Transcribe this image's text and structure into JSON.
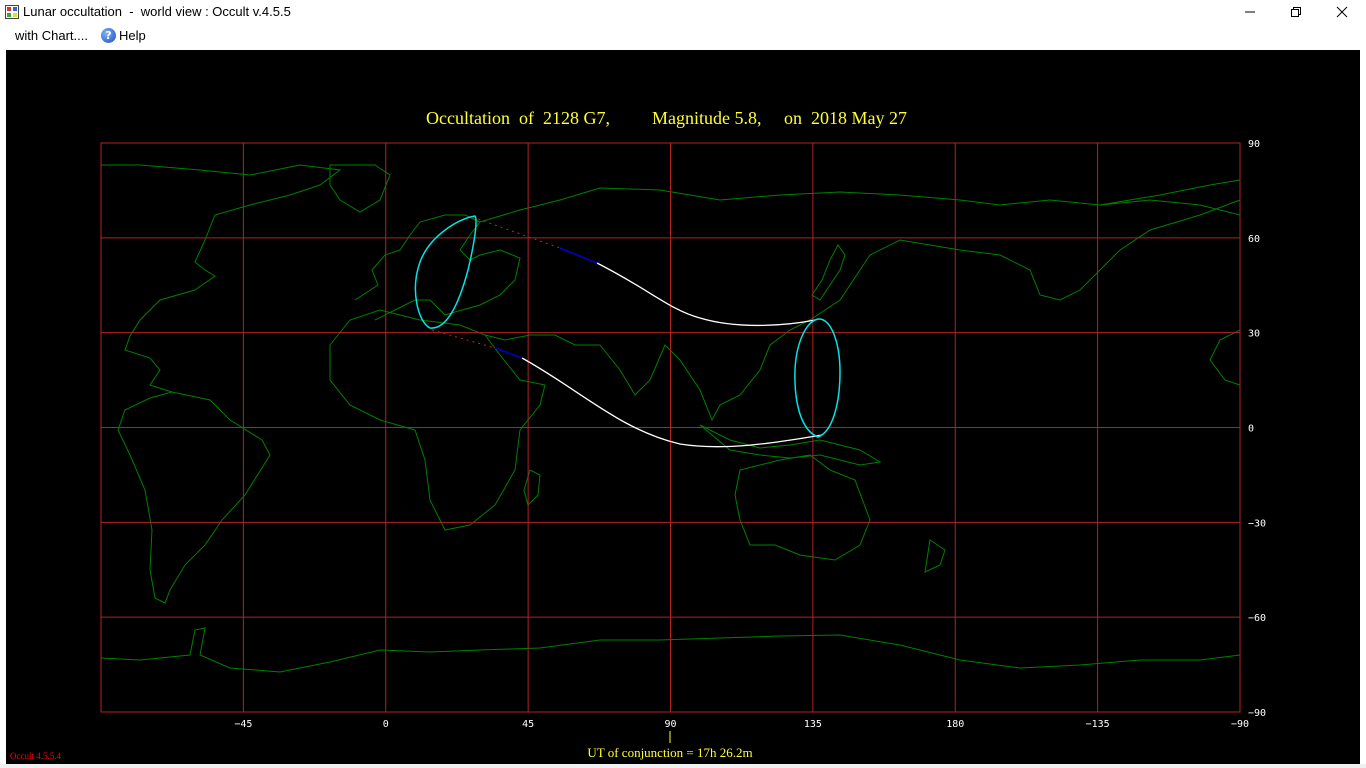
{
  "window": {
    "title": "Lunar occultation  -  world view : Occult v.4.5.5",
    "app_icon": "map-grid-icon",
    "controls": [
      "minimize-icon",
      "restore-icon",
      "close-icon"
    ]
  },
  "menu": {
    "items": [
      {
        "label": "with Chart...."
      },
      {
        "label": "Help",
        "icon": "help-icon"
      }
    ]
  },
  "chart": {
    "title_parts": [
      "Occultation  of  2128 G7,",
      "Magnitude 5.8,",
      "on  2018 May 27"
    ],
    "lon_ticks": [
      "−45",
      "0",
      "45",
      "90",
      "135",
      "180",
      "−135",
      "−90"
    ],
    "lat_ticks": [
      "90",
      "60",
      "30",
      "0",
      "−30",
      "−60",
      "−90"
    ],
    "conjunction_label": "UT of conjunction = 17h 26.2m",
    "version_label": "Occult 4.5.5.4",
    "colors": {
      "background": "#000000",
      "grid": "#b22222",
      "coastline": "#008000",
      "title": "#ffff33",
      "path": "#ffffff",
      "limit": "#00e5e5",
      "daylight_segment": "#0000cc",
      "dotted_segment": "#cc2222",
      "version": "#ff0000"
    }
  }
}
